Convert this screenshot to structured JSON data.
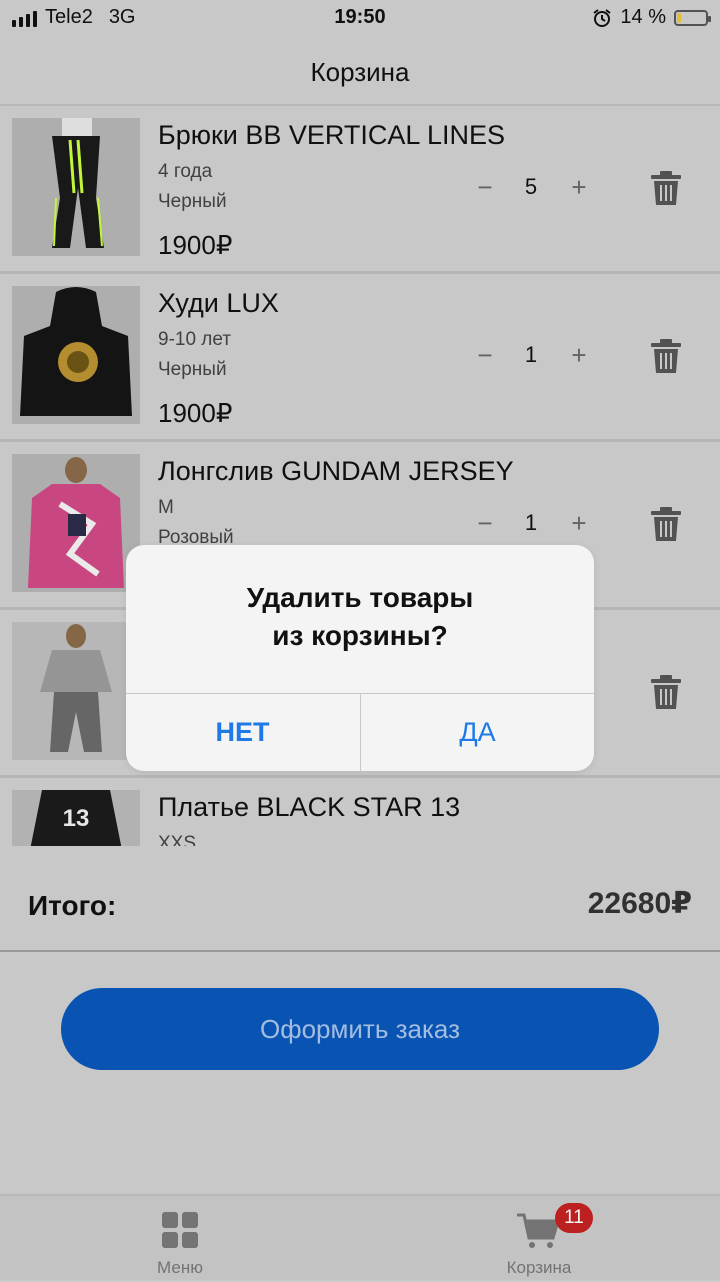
{
  "status": {
    "carrier": "Tele2",
    "network": "3G",
    "time": "19:50",
    "battery_percent": "14 %",
    "battery_level": 0.14
  },
  "nav": {
    "title": "Корзина"
  },
  "cart": {
    "items": [
      {
        "name": "Брюки BB VERTICAL LINES",
        "size": "4 года",
        "color": "Черный",
        "price": "1900₽",
        "qty": "5"
      },
      {
        "name": "Худи LUX",
        "size": "9-10 лет",
        "color": "Черный",
        "price": "1900₽",
        "qty": "1"
      },
      {
        "name": "Лонгслив GUNDAM JERSEY",
        "size": "M",
        "color": "Розовый",
        "price": "",
        "qty": "1"
      },
      {
        "name": "",
        "size": "",
        "color": "",
        "price": "",
        "qty": ""
      },
      {
        "name": "Платье BLACK STAR 13",
        "size": "XXS",
        "color": "",
        "price": "",
        "qty": ""
      }
    ],
    "minus": "−",
    "plus": "+"
  },
  "total": {
    "label": "Итого:",
    "value": "22680₽"
  },
  "order_button": "Оформить заказ",
  "tabbar": {
    "menu_label": "Меню",
    "cart_label": "Корзина",
    "cart_badge": "11"
  },
  "dialog": {
    "title_line1": "Удалить товары",
    "title_line2": "из корзины?",
    "no": "НЕТ",
    "yes": "ДА"
  },
  "colors": {
    "accent": "#0a56b9",
    "badge": "#c32222",
    "dialog_button": "#1f79e6"
  }
}
